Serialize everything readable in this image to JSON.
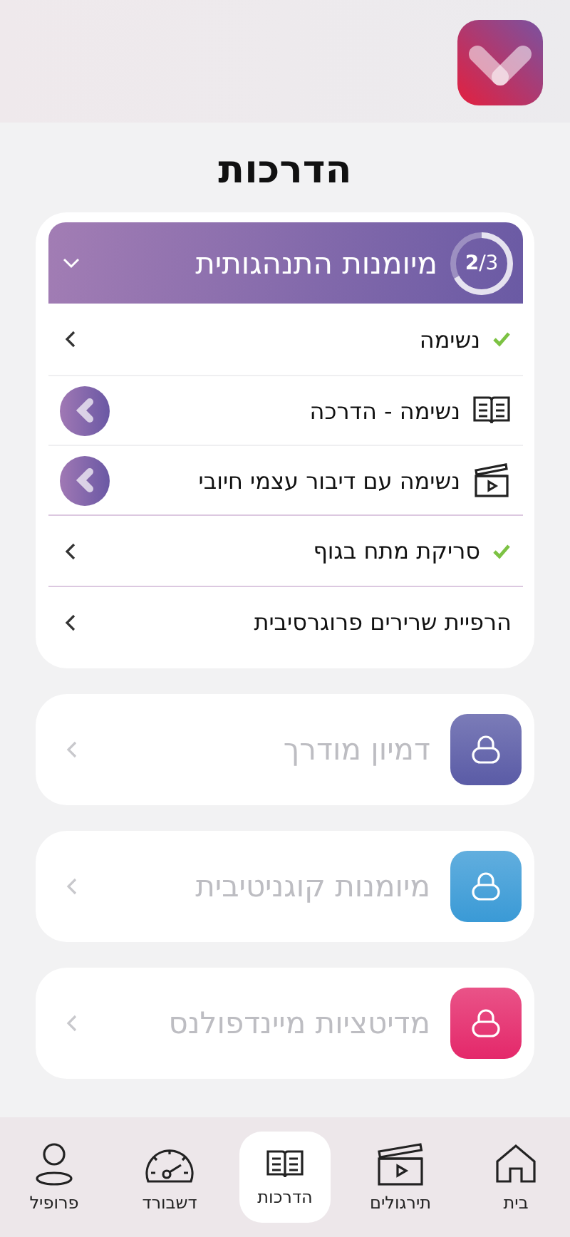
{
  "page": {
    "title": "הדרכות"
  },
  "program": {
    "title": "מיומנות התנהגותית",
    "progress": "**2**/3",
    "expanded": true,
    "items": [
      {
        "kind": "done",
        "label": "נשימה",
        "children": [
          {
            "kind": "guide",
            "label": "נשימה - הדרכה"
          },
          {
            "kind": "video",
            "label": "נשימה עם דיבור עצמי חיובי"
          }
        ]
      },
      {
        "kind": "done",
        "label": "סריקת מתח בגוף"
      },
      {
        "kind": "plain",
        "label": "הרפיית שרירים פרוגרסיבית"
      }
    ]
  },
  "locked_programs": [
    {
      "title": "דמיון מודרך",
      "color": "#5a5ba6"
    },
    {
      "title": "מיומנות קוגניטיבית",
      "color": "#3a9ad6"
    },
    {
      "title": "מדיטציות מיינדפולנס",
      "color": "#e4286a"
    }
  ],
  "nav": [
    {
      "kind": "home",
      "label": "בית",
      "selected": false
    },
    {
      "kind": "video",
      "label": "תירגולים",
      "selected": false
    },
    {
      "kind": "book",
      "label": "הדרכות",
      "selected": true
    },
    {
      "kind": "gauge",
      "label": "דשבורד",
      "selected": false
    },
    {
      "kind": "profile",
      "label": "פרופיל",
      "selected": false
    }
  ]
}
